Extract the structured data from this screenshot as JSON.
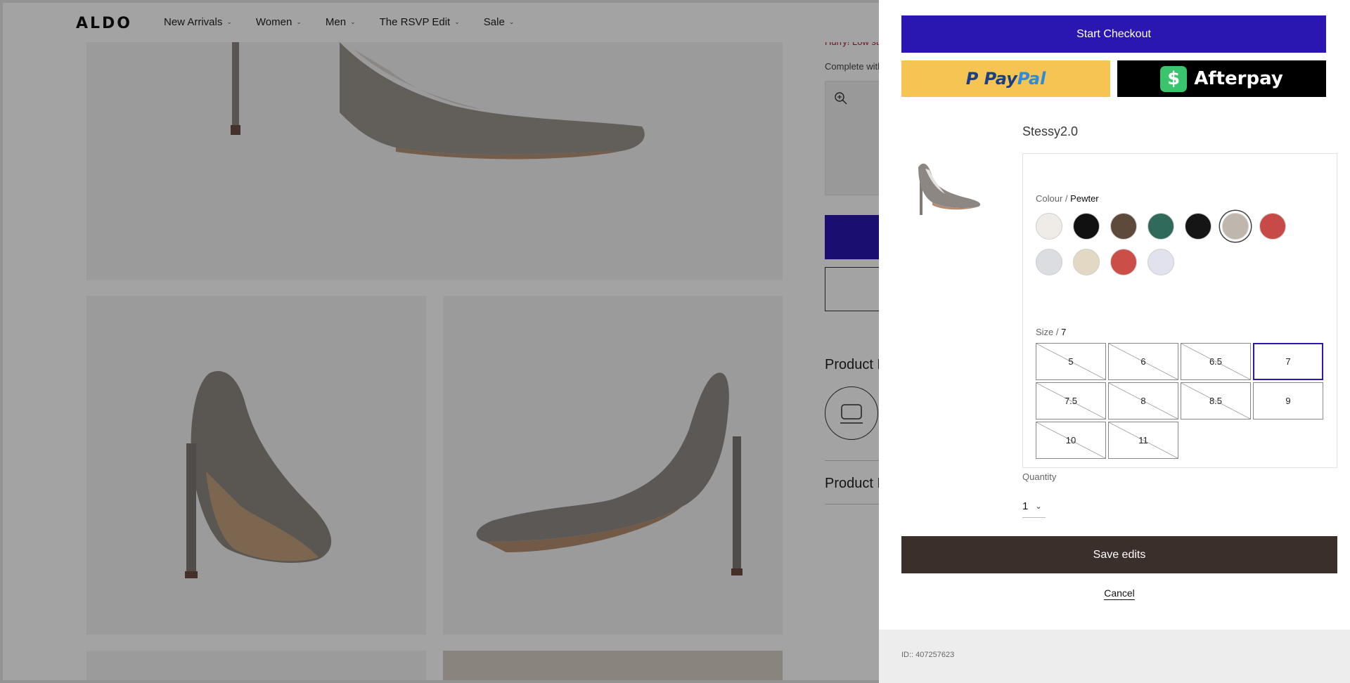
{
  "header": {
    "logo": "ALDO",
    "nav": [
      "New Arrivals",
      "Women",
      "Men",
      "The RSVP Edit",
      "Sale"
    ]
  },
  "background_page": {
    "stock_notice": "Hurry! Low st",
    "complete_text": "Complete with",
    "product_features_heading": "Product F",
    "product_details_heading": "Product D"
  },
  "drawer": {
    "checkout_label": "Start Checkout",
    "paypal": {
      "p": "Pay",
      "pal": "Pal"
    },
    "afterpay": {
      "badge": "$",
      "label": "Afterpay"
    },
    "product": {
      "name": "Stessy2.0",
      "image_icon": "pump-heel-icon"
    },
    "colour": {
      "label": "Colour",
      "separator": "/",
      "selected": "Pewter",
      "swatches": [
        {
          "name": "white",
          "color": "#efece8"
        },
        {
          "name": "black-patent",
          "color": "#111111"
        },
        {
          "name": "brown",
          "color": "#5e4a3b"
        },
        {
          "name": "green",
          "color": "#2f6a5a"
        },
        {
          "name": "black",
          "color": "#151515"
        },
        {
          "name": "pewter",
          "color": "#bfb7ad"
        },
        {
          "name": "red",
          "color": "#c84a46"
        },
        {
          "name": "silver-embellished",
          "color": "#dcdde0"
        },
        {
          "name": "gold-embellished",
          "color": "#e2d8c3"
        },
        {
          "name": "coral",
          "color": "#cc4e48"
        },
        {
          "name": "lilac-silver",
          "color": "#e2e2ee"
        }
      ]
    },
    "size": {
      "label": "Size",
      "separator": "/",
      "selected": "7",
      "options": [
        {
          "value": "5",
          "available": false
        },
        {
          "value": "6",
          "available": false
        },
        {
          "value": "6.5",
          "available": false
        },
        {
          "value": "7",
          "available": true
        },
        {
          "value": "7.5",
          "available": false
        },
        {
          "value": "8",
          "available": false
        },
        {
          "value": "8.5",
          "available": false
        },
        {
          "value": "9",
          "available": true
        },
        {
          "value": "10",
          "available": false
        },
        {
          "value": "11",
          "available": false
        }
      ]
    },
    "quantity": {
      "label": "Quantity",
      "value": "1"
    },
    "save_label": "Save edits",
    "cancel_label": "Cancel",
    "item_id": "ID:: 407257623"
  },
  "colors": {
    "accent_blue": "#2a17b1",
    "save_button": "#3b2f2b",
    "paypal_yellow": "#f6c453",
    "afterpay_green": "#3ac56d"
  }
}
